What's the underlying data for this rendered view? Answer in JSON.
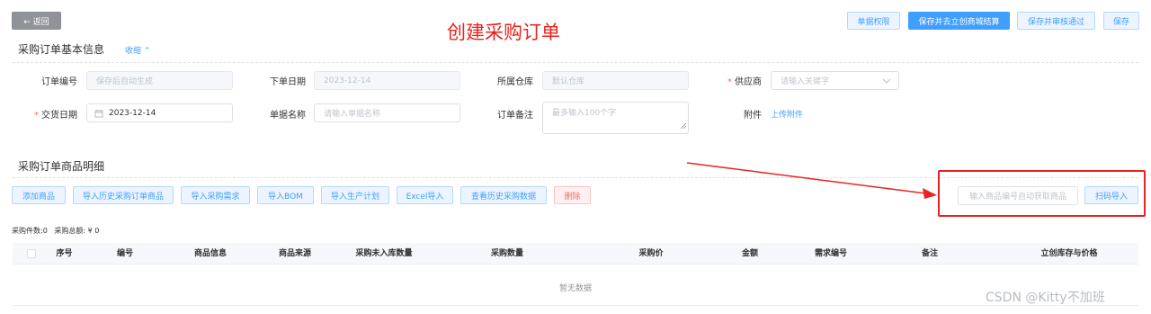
{
  "header": {
    "back_label": "← 返回",
    "page_title": "创建采购订单",
    "actions": {
      "permission": "单据权限",
      "save_settle": "保存并去立创商城结算",
      "save_approve": "保存并审核通过",
      "save": "保存"
    }
  },
  "basic_section": {
    "title": "采购订单基本信息",
    "collapse_label": "收缩 ⌃",
    "fields": {
      "order_no": {
        "label": "订单编号",
        "placeholder": "保存后自动生成"
      },
      "order_date": {
        "label": "下单日期",
        "value": "2023-12-14"
      },
      "warehouse": {
        "label": "所属仓库",
        "placeholder": "默认仓库"
      },
      "supplier": {
        "label": "供应商",
        "placeholder": "请输入关键字"
      },
      "delivery_date": {
        "label": "交货日期",
        "value": "2023-12-14"
      },
      "doc_name": {
        "label": "单据名称",
        "placeholder": "请输入单据名称"
      },
      "remark": {
        "label": "订单备注",
        "placeholder": "最多输入100个字"
      },
      "attachment": {
        "label": "附件",
        "link": "上传附件"
      }
    }
  },
  "detail_section": {
    "title": "采购订单商品明细",
    "toolbar": [
      "添加商品",
      "导入历史采购订单商品",
      "导入采购需求",
      "导入BOM",
      "导入生产计划",
      "Excel导入",
      "查看历史采购数据",
      "删除"
    ],
    "scan": {
      "placeholder": "输入商品编号自动获取商品",
      "button": "扫码导入"
    },
    "summary": "采购件数:0   采购总额: ¥ 0",
    "columns": [
      "序号",
      "编号",
      "商品信息",
      "商品来源",
      "采购未入库数量",
      "采购数量",
      "采购价",
      "金额",
      "需求编号",
      "备注",
      "立创库存与价格"
    ],
    "empty_text": "暂无数据"
  },
  "watermark": "CSDN @Kitty不加班",
  "colors": {
    "primary": "#409eff",
    "danger": "#f56c6c",
    "annotation_red": "#e8231f"
  }
}
